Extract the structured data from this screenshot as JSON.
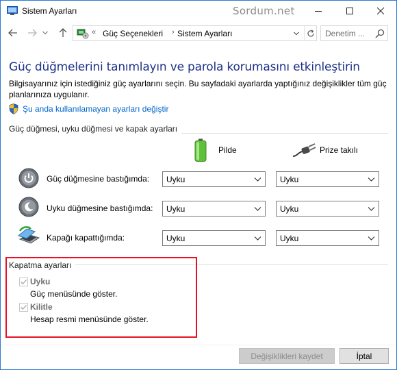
{
  "window": {
    "title": "Sistem Ayarları",
    "watermark": "Sordum.net"
  },
  "address": {
    "chevron": "«",
    "segment1": "Güç Seçenekleri",
    "separator": "›",
    "segment2": "Sistem Ayarları"
  },
  "search": {
    "placeholder": "Denetim ..."
  },
  "content": {
    "heading": "Güç düğmelerini tanımlayın ve parola korumasını etkinleştirin",
    "description": "Bilgisayarınız için istediğiniz güç ayarlarını seçin. Bu sayfadaki ayarlarda yaptığınız değişiklikler tüm güç planlarınıza uygulanır.",
    "admin_link": "Şu anda kullanılamayan ayarları değiştir"
  },
  "power_group": {
    "title": "Güç düğmesi, uyku düğmesi ve kapak ayarları",
    "col_battery": "Pilde",
    "col_plugged": "Prize takılı",
    "rows": [
      {
        "label": "Güç düğmesine bastığımda:",
        "battery": "Uyku",
        "plugged": "Uyku"
      },
      {
        "label": "Uyku düğmesine bastığımda:",
        "battery": "Uyku",
        "plugged": "Uyku"
      },
      {
        "label": "Kapağı kapattığımda:",
        "battery": "Uyku",
        "plugged": "Uyku"
      }
    ]
  },
  "shutdown_group": {
    "title": "Kapatma ayarları",
    "options": [
      {
        "label": "Uyku",
        "desc": "Güç menüsünde göster.",
        "checked": true
      },
      {
        "label": "Kilitle",
        "desc": "Hesap resmi menüsünde göster.",
        "checked": true
      }
    ]
  },
  "buttons": {
    "save": "Değişiklikleri kaydet",
    "cancel": "İptal"
  },
  "colors": {
    "heading": "#1e3287",
    "link": "#0066cc",
    "highlight_box": "#e81123"
  }
}
